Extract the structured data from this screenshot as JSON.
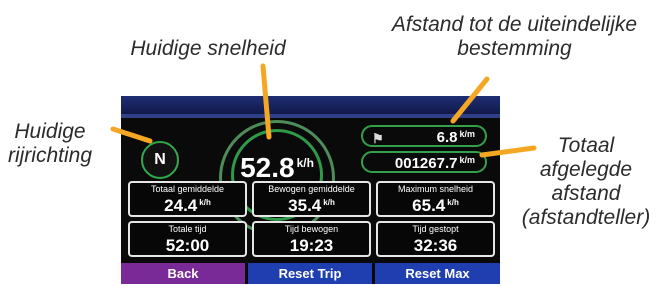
{
  "callouts": {
    "heading": [
      "Huidige",
      "rijrichting"
    ],
    "speed": "Huidige snelheid",
    "destination": [
      "Afstand tot de uiteindelijke",
      "bestemming"
    ],
    "odometer": [
      "Totaal",
      "afgelegde",
      "afstand",
      "(afstandteller)"
    ]
  },
  "device": {
    "compass": "N",
    "speed": {
      "value": "52.8",
      "unit": "k/h"
    },
    "distance_to_destination": {
      "value": "6.8",
      "unit": "k/m"
    },
    "odometer": {
      "value": "001267.7",
      "unit": "k/m"
    },
    "fields": [
      {
        "label": "Totaal gemiddelde",
        "value": "24.4",
        "unit": "k/h"
      },
      {
        "label": "Bewogen gemiddelde",
        "value": "35.4",
        "unit": "k/h"
      },
      {
        "label": "Maximum snelheid",
        "value": "65.4",
        "unit": "k/h"
      },
      {
        "label": "Totale tijd",
        "value": "52:00"
      },
      {
        "label": "Tijd bewogen",
        "value": "19:23"
      },
      {
        "label": "Tijd gestopt",
        "value": "32:36"
      }
    ],
    "buttons": [
      {
        "label": "Back",
        "color": "#7a2a96"
      },
      {
        "label": "Reset Trip",
        "color": "#1f3fb0"
      },
      {
        "label": "Reset Max",
        "color": "#1f3fb0"
      }
    ]
  },
  "colors": {
    "callout_leader": "#f5a623",
    "dial_green": "#2f9a48"
  }
}
